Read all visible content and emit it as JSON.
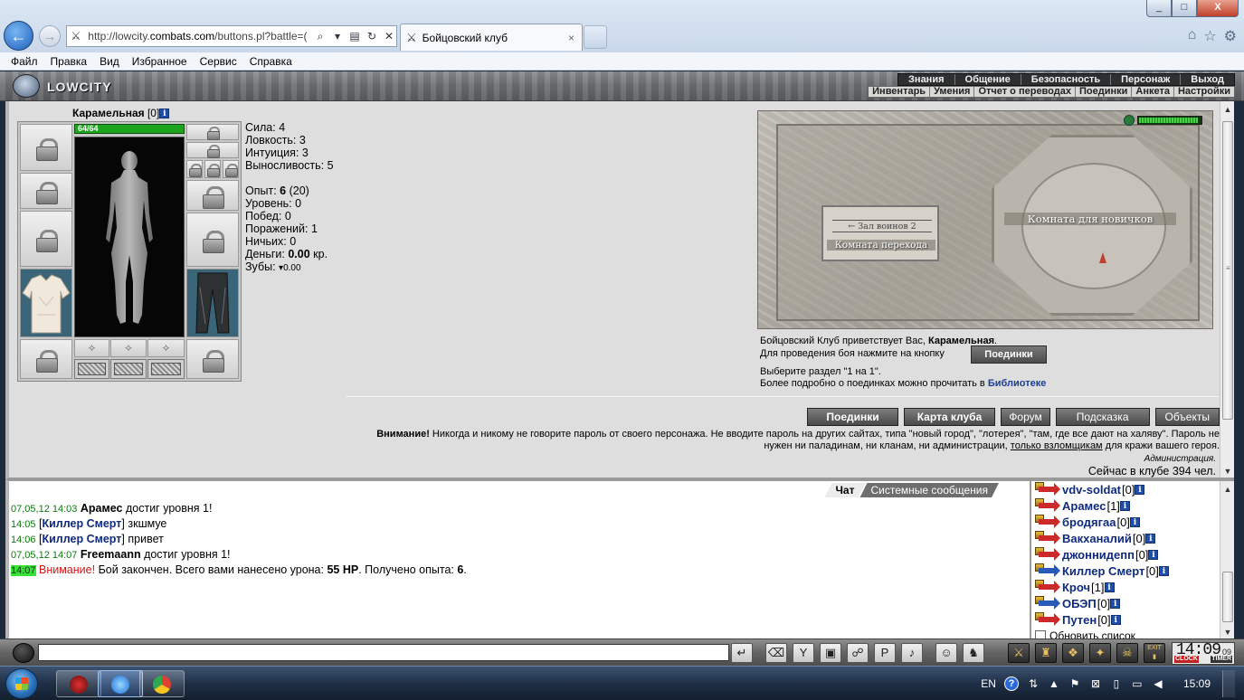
{
  "browser": {
    "url_prefix": "http://lowcity.",
    "url_domain": "combats.com",
    "url_path": "/buttons.pl?battle=(",
    "tab_title": "Бойцовский клуб",
    "tab_close": "×",
    "window_min": "_",
    "window_max": "□",
    "window_close": "X",
    "back_glyph": "←",
    "forward_glyph": "→",
    "menu": [
      "Файл",
      "Правка",
      "Вид",
      "Избранное",
      "Сервис",
      "Справка"
    ],
    "icons": [
      "home-icon",
      "star-icon",
      "gear-icon",
      "search-icon",
      "refresh-icon",
      "stop-icon"
    ]
  },
  "game_header": {
    "logo": "LOWCITY",
    "nav_top": [
      "Знания",
      "Общение",
      "Безопасность",
      "Персонаж",
      "Выход"
    ],
    "nav_bottom": [
      "Инвентарь",
      "Умения",
      "Отчет о переводах",
      "Поединки",
      "Анкета",
      "Настройки"
    ]
  },
  "character": {
    "name": "Карамельная",
    "level": "[0]",
    "info": "i",
    "hp": "64/64",
    "hp_fraction": 1.0,
    "stats": [
      {
        "label": "Сила:",
        "value": "4"
      },
      {
        "label": "Ловкость:",
        "value": "3"
      },
      {
        "label": "Интуиция:",
        "value": "3"
      },
      {
        "label": "Выносливость:",
        "value": "5"
      }
    ],
    "exp_label": "Опыт:",
    "exp_value": "6",
    "exp_next": "(20)",
    "records": [
      {
        "label": "Уровень:",
        "value": "0"
      },
      {
        "label": "Побед:",
        "value": "0"
      },
      {
        "label": "Поражений:",
        "value": "1"
      },
      {
        "label": "Ничьих:",
        "value": "0"
      }
    ],
    "money_label": "Деньги:",
    "money_value": "0.00",
    "money_unit": "кр.",
    "teeth_label": "Зубы:",
    "teeth_value": "0.00"
  },
  "map": {
    "trans_sign": "← Зал воинов 2",
    "trans_room": "Комната перехода",
    "newbie_room": "Комната для новичков",
    "gauge_fraction": 0.95
  },
  "welcome": {
    "line1_prefix": "Бойцовский Клуб приветствует Вас, ",
    "line1_name": "Карамельная",
    "line1_suffix": ".",
    "fight_prompt": "Для проведения боя нажмите на кнопку",
    "fight_button": "Поединки",
    "section_line": "Выберите раздел \"1 на 1\".",
    "more_prefix": "Более подробно о поединках можно прочитать в ",
    "more_link": "Библиотеке"
  },
  "buttons": [
    "Поединки",
    "Карта клуба",
    "Форум",
    "Подсказка",
    "Объекты"
  ],
  "warning": {
    "bold": "Внимание!",
    "text1": " Никогда и никому не говорите пароль от своего персонажа. Не вводите пароль на других сайтах, типа \"новый город\", \"лотерея\", \"там, где все дают на халяву\". Пароль не нужен ни паладинам, ни кланам, ни администрации, ",
    "underline": "только взломщикам",
    "text2": " для кражи вашего героя.",
    "signature": "Администрация.",
    "online": "Сейчас в клубе 394 чел."
  },
  "chat": {
    "tab_chat": "Чат",
    "tab_system": "Системные сообщения",
    "messages": [
      {
        "ts": "07,05,12 14:03",
        "nick": "Арамес",
        "text": " достиг уровня 1!"
      },
      {
        "ts": "14:05",
        "nick": "Киллер Смерт",
        "text": " зкшмуе"
      },
      {
        "ts": "14:06",
        "nick": "Киллер Смерт",
        "text": " привет"
      },
      {
        "ts": "07,05,12 14:07",
        "nick": "Freemaann",
        "text": " достиг уровня 1!"
      },
      {
        "ts": "14:07",
        "alert": "Внимание!",
        "text_a": " Бой закончен. Всего вами нанесено урона: ",
        "hp": "55 HP",
        "text_b": ". Получено опыта: ",
        "exp": "6",
        "text_c": "."
      }
    ]
  },
  "online_users": [
    {
      "name": "vdv-soldat",
      "lvl": "[0]",
      "color": "red"
    },
    {
      "name": "Арамес",
      "lvl": "[1]",
      "color": "red"
    },
    {
      "name": "бродягаа",
      "lvl": "[0]",
      "color": "red"
    },
    {
      "name": "Вакханалий",
      "lvl": "[0]",
      "color": "red"
    },
    {
      "name": "джоннидепп",
      "lvl": "[0]",
      "color": "red"
    },
    {
      "name": "Киллер Смерт",
      "lvl": "[0]",
      "color": "blue"
    },
    {
      "name": "Кроч",
      "lvl": "[1]",
      "color": "red"
    },
    {
      "name": "ОБЭП",
      "lvl": "[0]",
      "color": "blue"
    },
    {
      "name": "Путен",
      "lvl": "[0]",
      "color": "red"
    }
  ],
  "online_filter": "Обновить список",
  "toolbar": {
    "clock": "14:09",
    "seconds": "09",
    "clock_label": "CLOCK",
    "timer_label": "TIMER",
    "exit_label": "EXIT"
  },
  "taskbar": {
    "lang": "EN",
    "help": "?",
    "time": "15:09"
  }
}
